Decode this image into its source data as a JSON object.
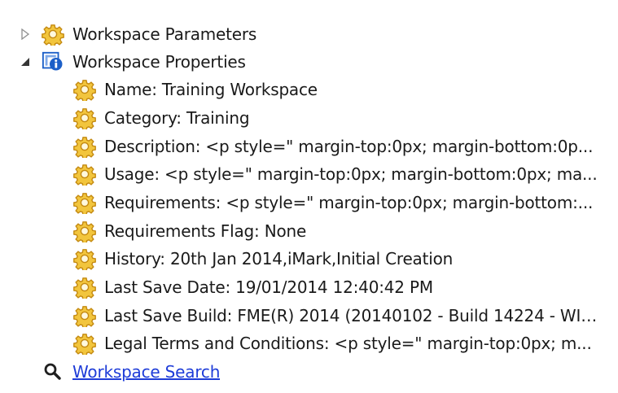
{
  "tree": {
    "workspace_parameters": {
      "label": "Workspace Parameters",
      "expanded": false,
      "icon": "gear-icon"
    },
    "workspace_properties": {
      "label": "Workspace Properties",
      "expanded": true,
      "icon": "info-icon",
      "children": [
        {
          "label": "Name: Training Workspace",
          "icon": "gear-icon"
        },
        {
          "label": "Category: Training",
          "icon": "gear-icon"
        },
        {
          "label": "Description: <p style=\" margin-top:0px; margin-bottom:0p...",
          "icon": "gear-icon"
        },
        {
          "label": "Usage: <p style=\" margin-top:0px; margin-bottom:0px; ma...",
          "icon": "gear-icon"
        },
        {
          "label": "Requirements: <p style=\" margin-top:0px; margin-bottom:...",
          "icon": "gear-icon"
        },
        {
          "label": "Requirements Flag: None",
          "icon": "gear-icon"
        },
        {
          "label": "History: 20th Jan 2014,iMark,Initial Creation",
          "icon": "gear-icon"
        },
        {
          "label": "Last Save Date: 19/01/2014 12:40:42 PM",
          "icon": "gear-icon"
        },
        {
          "label": "Last Save Build: FME(R) 2014 (20140102 - Build 14224 - WIN...",
          "icon": "gear-icon"
        },
        {
          "label": "Legal Terms and Conditions: <p style=\" margin-top:0px; m...",
          "icon": "gear-icon"
        }
      ]
    },
    "workspace_search": {
      "label": "Workspace Search",
      "icon": "search-icon"
    }
  },
  "colors": {
    "gear_fill": "#f2c53d",
    "gear_stroke": "#c48a12",
    "info_blue": "#1c5fc8",
    "link": "#1e3cd8"
  }
}
